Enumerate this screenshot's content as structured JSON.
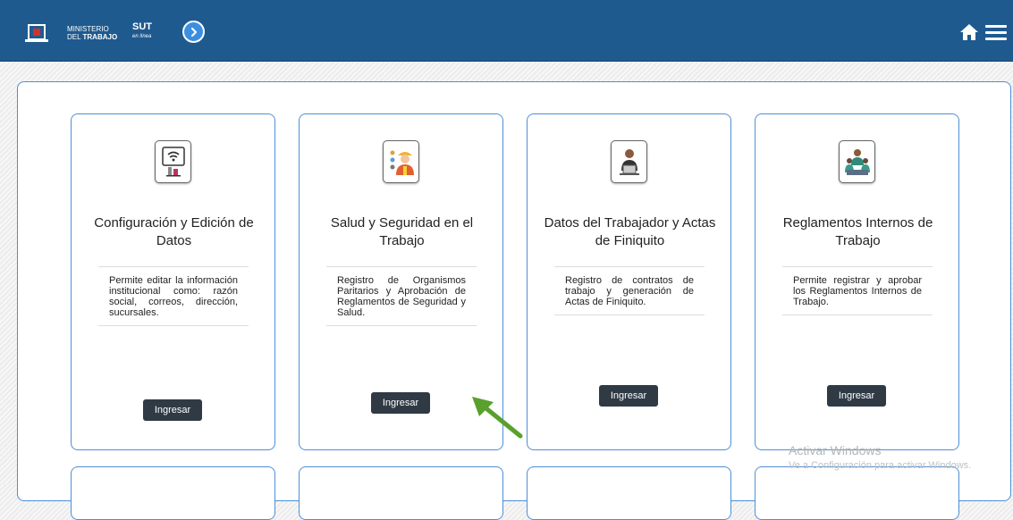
{
  "header": {
    "ministry_line1": "MINISTERIO",
    "ministry_line2_prefix": "DEL",
    "ministry_line2": "TRABAJO",
    "sut": "SUT",
    "sut_sub": "en línea",
    "home_icon": "home-icon",
    "menu_icon": "hamburger-menu-icon",
    "bar_color": "#1f5a8f"
  },
  "cards": [
    {
      "title": "Configuración y Edición de Datos",
      "description": "Permite editar la información institucional como: razón social, correos, dirección, sucursales.",
      "button": "Ingresar",
      "icon": "wifi-computer-icon"
    },
    {
      "title": "Salud y Seguridad en el Trabajo",
      "description": "Registro de Organismos Paritarios y Aprobación de Reglamentos de Seguridad y Salud.",
      "button": "Ingresar",
      "icon": "safety-worker-icon"
    },
    {
      "title": "Datos del Trabajador y Actas de Finiquito",
      "description": "Registro de contratos de trabajo y generación de Actas de Finiquito.",
      "button": "Ingresar",
      "icon": "worker-laptop-icon"
    },
    {
      "title": "Reglamentos Internos de Trabajo",
      "description": "Permite registrar y aprobar los Reglamentos Internos de Trabajo.",
      "button": "Ingresar",
      "icon": "team-meeting-icon"
    }
  ],
  "watermark": {
    "line1": "Activar Windows",
    "line2": "Ve a Configuración para activar Windows."
  },
  "accent_color": "#4d8fd6"
}
